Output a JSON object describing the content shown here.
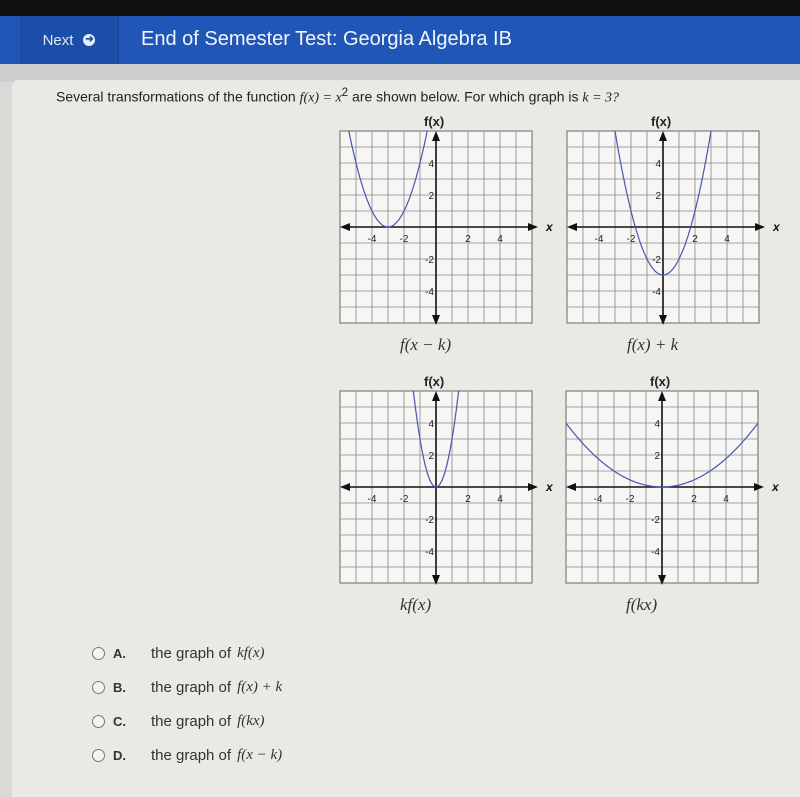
{
  "header": {
    "next_label": "Next",
    "next_icon": "arrow-right-circle-icon",
    "title": "End of Semester Test: Georgia Algebra IB",
    "bar_color": "#1f56b8"
  },
  "question": {
    "prefix": "Several transformations of the function ",
    "func": "f(x) = x",
    "exp": "2",
    "suffix": " are shown below. For which graph is ",
    "kvar": "k = 3?"
  },
  "chart_data": [
    {
      "type": "line",
      "ylabel": "f(x)",
      "xlabel": "x",
      "caption": "f(x − k)",
      "xlim": [
        -6,
        6
      ],
      "ylim": [
        -6,
        6
      ],
      "xticks": [
        "-4",
        "-2",
        "2",
        "4"
      ],
      "yticks": [
        "4",
        "2",
        "-2",
        "-4"
      ],
      "grid": true,
      "curve": {
        "equation": "y = (x + 3)^2",
        "a": 1,
        "h": -3,
        "k": 0
      },
      "color": "#4a55b0"
    },
    {
      "type": "line",
      "ylabel": "f(x)",
      "xlabel": "x",
      "caption": "f(x) + k",
      "xlim": [
        -6,
        6
      ],
      "ylim": [
        -6,
        6
      ],
      "xticks": [
        "-4",
        "-2",
        "2",
        "4"
      ],
      "yticks": [
        "4",
        "2",
        "-2",
        "-4"
      ],
      "grid": true,
      "curve": {
        "equation": "y = x^2 - 3",
        "a": 1,
        "h": 0,
        "k": -3
      },
      "color": "#4a55b0"
    },
    {
      "type": "line",
      "ylabel": "f(x)",
      "xlabel": "x",
      "caption": "kf(x)",
      "xlim": [
        -6,
        6
      ],
      "ylim": [
        -6,
        6
      ],
      "xticks": [
        "-4",
        "-2",
        "2",
        "4"
      ],
      "yticks": [
        "4",
        "2",
        "-2",
        "-4"
      ],
      "grid": true,
      "curve": {
        "equation": "y = 3x^2",
        "a": 3,
        "h": 0,
        "k": 0
      },
      "color": "#4a55b0"
    },
    {
      "type": "line",
      "ylabel": "f(x)",
      "xlabel": "x",
      "caption": "f(kx)",
      "xlim": [
        -6,
        6
      ],
      "ylim": [
        -6,
        6
      ],
      "xticks": [
        "-4",
        "-2",
        "2",
        "4"
      ],
      "yticks": [
        "4",
        "2",
        "-2",
        "-4"
      ],
      "grid": true,
      "curve": {
        "equation": "y = x^2 / 9",
        "a": 0.111,
        "h": 0,
        "k": 0
      },
      "color": "#4a55b0"
    }
  ],
  "options": [
    {
      "letter": "A.",
      "text": "the graph of",
      "math": "kf(x)"
    },
    {
      "letter": "B.",
      "text": "the graph of",
      "math": "f(x) + k"
    },
    {
      "letter": "C.",
      "text": "the graph of",
      "math": "f(kx)"
    },
    {
      "letter": "D.",
      "text": "the graph of",
      "math": "f(x − k)"
    }
  ]
}
